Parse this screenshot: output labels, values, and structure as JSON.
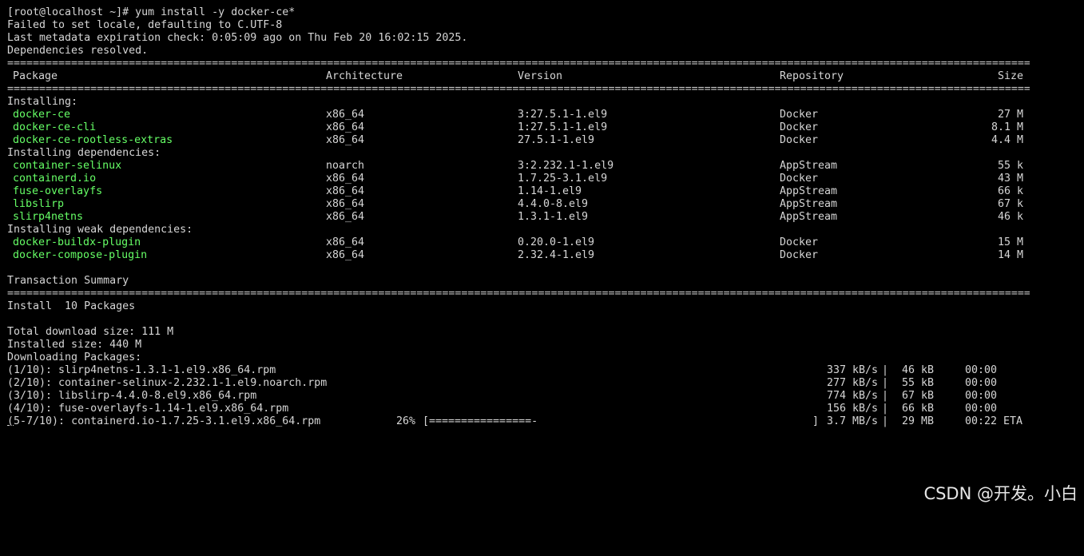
{
  "terminal": {
    "preamble": [
      "[root@localhost ~]# yum install -y docker-ce*",
      "Failed to set locale, defaulting to C.UTF-8",
      "Last metadata expiration check: 0:05:09 ago on Thu Feb 20 16:02:15 2025.",
      "Dependencies resolved."
    ],
    "rule_char": "=",
    "headers": {
      "package": "Package",
      "arch": "Architecture",
      "version": "Version",
      "repo": "Repository",
      "size": "Size"
    },
    "groups": [
      {
        "label": "Installing:",
        "rows": [
          {
            "package": "docker-ce",
            "arch": "x86_64",
            "version": "3:27.5.1-1.el9",
            "repo": "Docker",
            "size": "27 M"
          },
          {
            "package": "docker-ce-cli",
            "arch": "x86_64",
            "version": "1:27.5.1-1.el9",
            "repo": "Docker",
            "size": "8.1 M"
          },
          {
            "package": "docker-ce-rootless-extras",
            "arch": "x86_64",
            "version": "27.5.1-1.el9",
            "repo": "Docker",
            "size": "4.4 M"
          }
        ]
      },
      {
        "label": "Installing dependencies:",
        "rows": [
          {
            "package": "container-selinux",
            "arch": "noarch",
            "version": "3:2.232.1-1.el9",
            "repo": "AppStream",
            "size": "55 k"
          },
          {
            "package": "containerd.io",
            "arch": "x86_64",
            "version": "1.7.25-3.1.el9",
            "repo": "Docker",
            "size": "43 M"
          },
          {
            "package": "fuse-overlayfs",
            "arch": "x86_64",
            "version": "1.14-1.el9",
            "repo": "AppStream",
            "size": "66 k"
          },
          {
            "package": "libslirp",
            "arch": "x86_64",
            "version": "4.4.0-8.el9",
            "repo": "AppStream",
            "size": "67 k"
          },
          {
            "package": "slirp4netns",
            "arch": "x86_64",
            "version": "1.3.1-1.el9",
            "repo": "AppStream",
            "size": "46 k"
          }
        ]
      },
      {
        "label": "Installing weak dependencies:",
        "rows": [
          {
            "package": "docker-buildx-plugin",
            "arch": "x86_64",
            "version": "0.20.0-1.el9",
            "repo": "Docker",
            "size": "15 M"
          },
          {
            "package": "docker-compose-plugin",
            "arch": "x86_64",
            "version": "2.32.4-1.el9",
            "repo": "Docker",
            "size": "14 M"
          }
        ]
      }
    ],
    "transaction_summary": "Transaction Summary",
    "install_line": "Install  10 Packages",
    "total_download": "Total download size: 111 M",
    "installed_size": "Installed size: 440 M",
    "downloading_label": "Downloading Packages:",
    "downloads": [
      {
        "name": "(1/10): slirp4netns-1.3.1-1.el9.x86_64.rpm",
        "speed": "337 kB/s",
        "size": "46 kB",
        "time": "00:00"
      },
      {
        "name": "(2/10): container-selinux-2.232.1-1.el9.noarch.rpm",
        "speed": "277 kB/s",
        "size": "55 kB",
        "time": "00:00"
      },
      {
        "name": "(3/10): libslirp-4.4.0-8.el9.x86_64.rpm",
        "speed": "774 kB/s",
        "size": "67 kB",
        "time": "00:00"
      },
      {
        "name": "(4/10): fuse-overlayfs-1.14-1.el9.x86_64.rpm",
        "speed": "156 kB/s",
        "size": "66 kB",
        "time": "00:00"
      }
    ],
    "progress": {
      "cursor_char": "(",
      "name": "5-7/10): containerd.io-1.7.25-3.1.el9.x86_64.rpm",
      "percent": "26%",
      "bar_open": "[",
      "bar_fill": "================-",
      "bar_close": "]",
      "speed": "3.7 MB/s",
      "size": "29 MB",
      "eta": "00:22 ETA"
    },
    "separator": "|"
  },
  "watermark": "CSDN @开发。小白",
  "colors": {
    "background": "#000000",
    "text": "#d6d6d6",
    "package_name": "#66ff66"
  }
}
